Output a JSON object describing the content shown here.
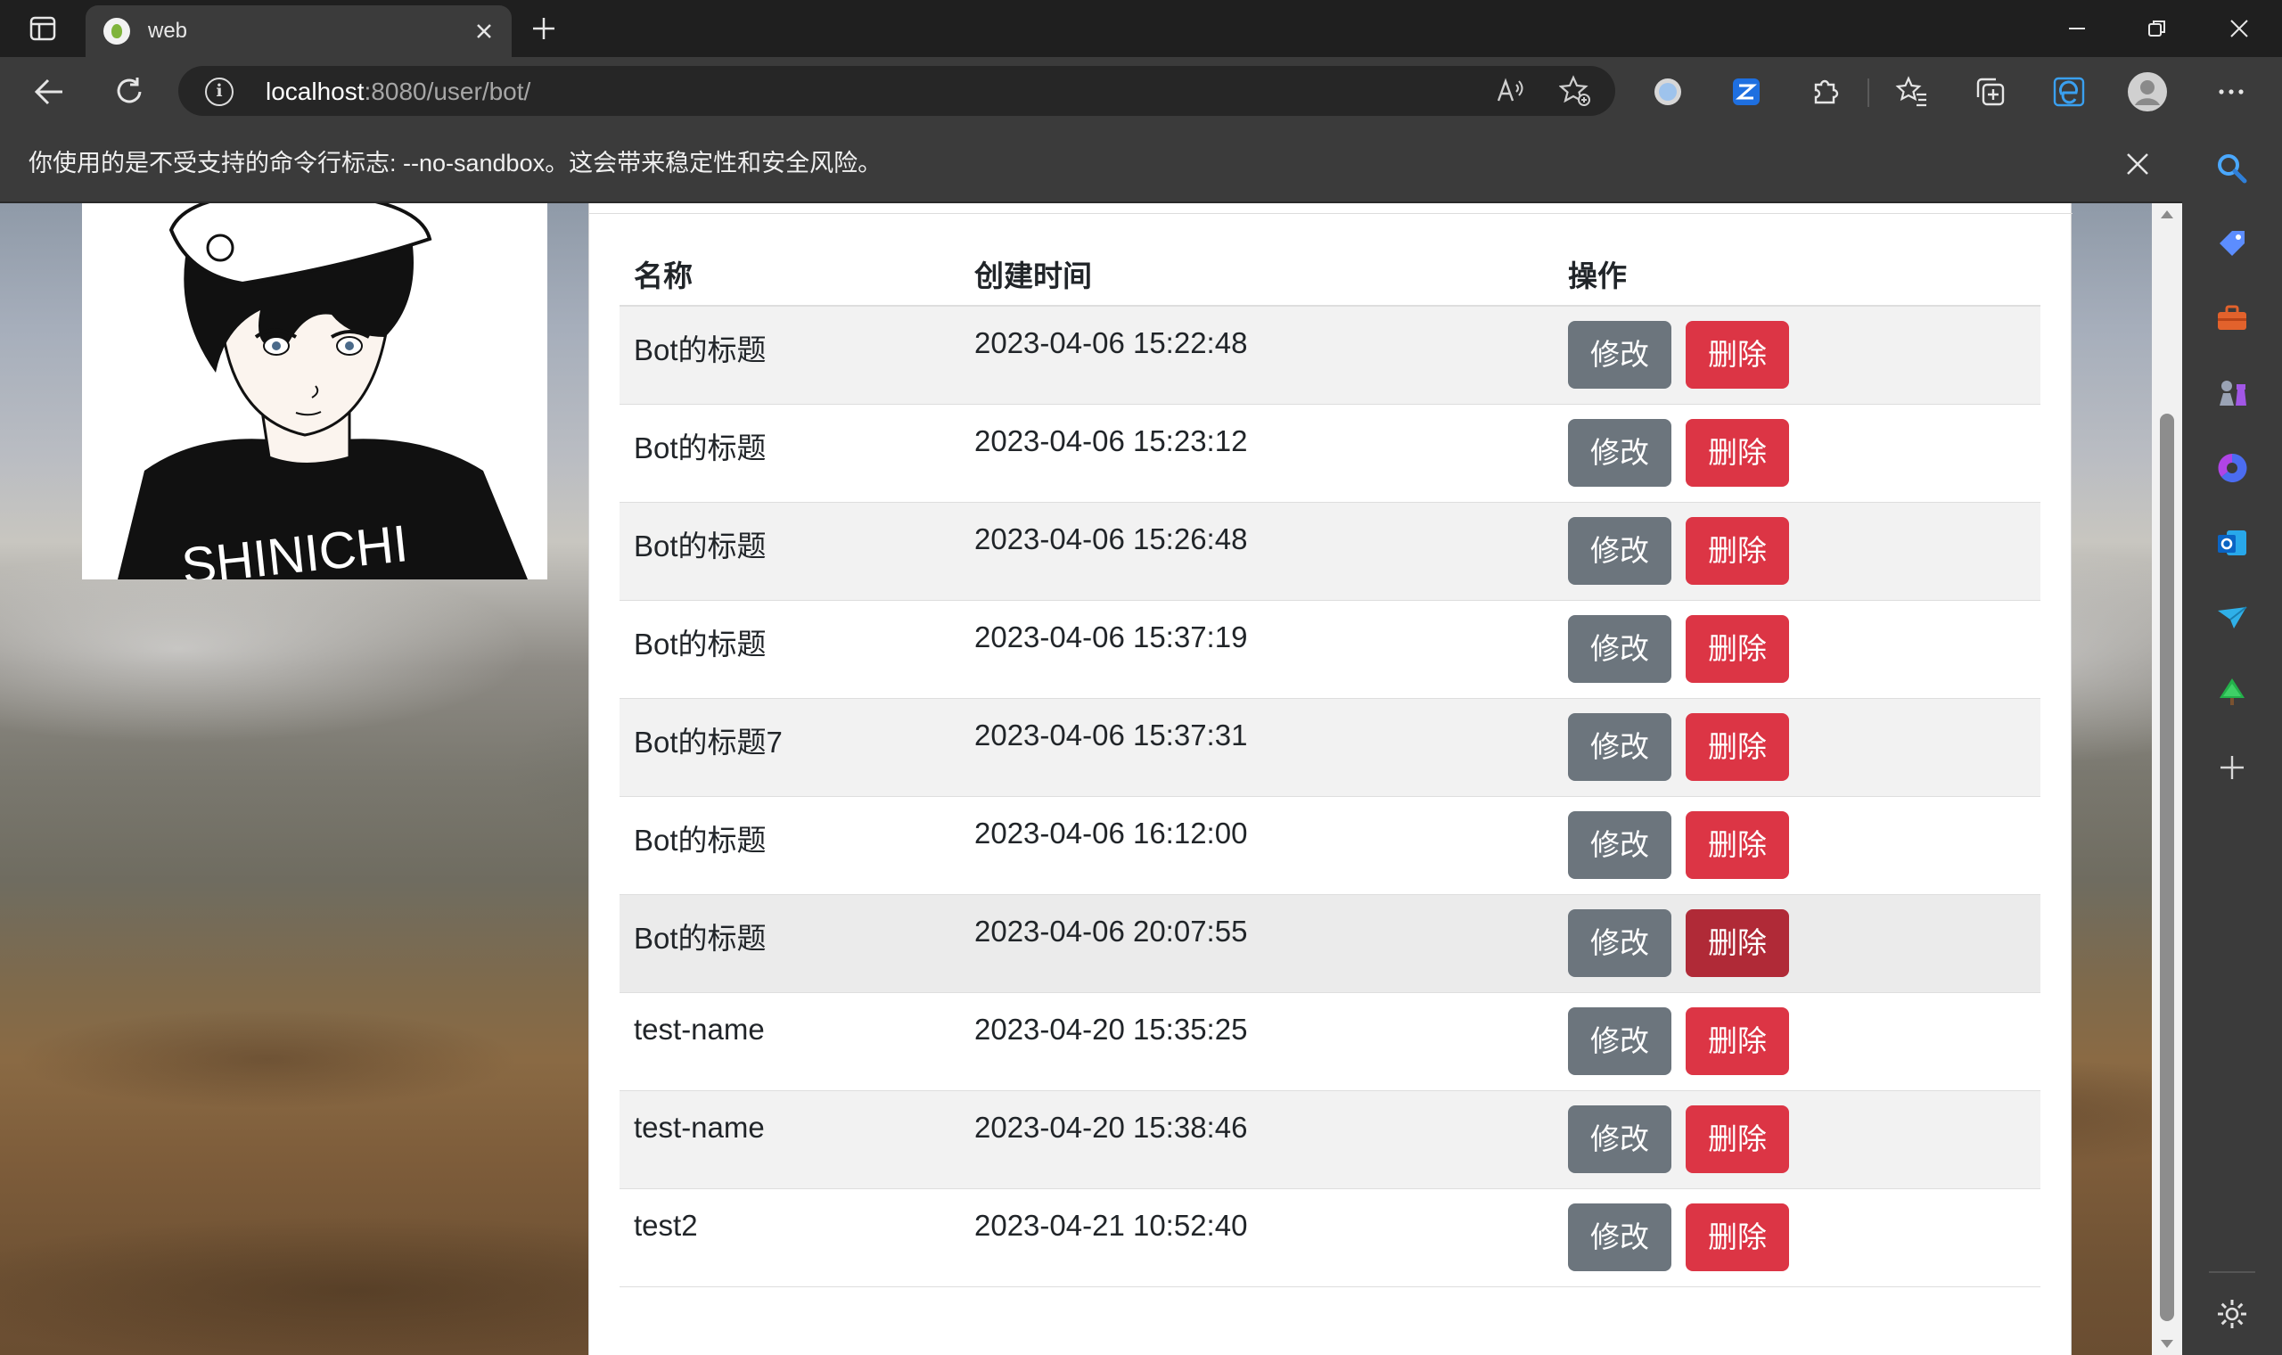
{
  "browser": {
    "tab_title": "web",
    "url_host": "localhost",
    "url_rest": ":8080/user/bot/",
    "infobar_message": "你使用的是不受支持的命令行标志: --no-sandbox。这会带来稳定性和安全风险。"
  },
  "avatar": {
    "shirt_text": "SHINICHI"
  },
  "table": {
    "headers": {
      "name": "名称",
      "created": "创建时间",
      "actions": "操作"
    },
    "rows": [
      {
        "name": "Bot的标题",
        "created": "2023-04-06 15:22:48",
        "edit": "修改",
        "delete": "删除"
      },
      {
        "name": "Bot的标题",
        "created": "2023-04-06 15:23:12",
        "edit": "修改",
        "delete": "删除"
      },
      {
        "name": "Bot的标题",
        "created": "2023-04-06 15:26:48",
        "edit": "修改",
        "delete": "删除"
      },
      {
        "name": "Bot的标题",
        "created": "2023-04-06 15:37:19",
        "edit": "修改",
        "delete": "删除"
      },
      {
        "name": "Bot的标题7",
        "created": "2023-04-06 15:37:31",
        "edit": "修改",
        "delete": "删除"
      },
      {
        "name": "Bot的标题",
        "created": "2023-04-06 16:12:00",
        "edit": "修改",
        "delete": "删除"
      },
      {
        "name": "Bot的标题",
        "created": "2023-04-06 20:07:55",
        "edit": "修改",
        "delete": "删除"
      },
      {
        "name": "test-name",
        "created": "2023-04-20 15:35:25",
        "edit": "修改",
        "delete": "删除"
      },
      {
        "name": "test-name",
        "created": "2023-04-20 15:38:46",
        "edit": "修改",
        "delete": "删除"
      },
      {
        "name": "test2",
        "created": "2023-04-21 10:52:40",
        "edit": "修改",
        "delete": "删除"
      }
    ]
  },
  "colors": {
    "edit_button": "#6c757d",
    "delete_button": "#dc3545",
    "delete_button_active": "#b02a37",
    "chrome_dark": "#1f1f1f",
    "chrome_toolbar": "#3b3b3b"
  },
  "icons": {
    "browser_toolbar": [
      "back-icon",
      "refresh-icon",
      "info-icon",
      "read-aloud-icon",
      "add-favorite-icon",
      "extension-circle-icon",
      "extension-z-icon",
      "extensions-puzzle-icon",
      "favorites-icon",
      "collections-icon",
      "edge-icon",
      "profile-avatar-icon",
      "more-menu-icon"
    ],
    "sidebar": [
      "search-icon",
      "tag-icon",
      "toolbox-icon",
      "chess-icon",
      "copilot-icon",
      "outlook-icon",
      "send-icon",
      "tree-icon",
      "add-icon",
      "settings-gear-icon"
    ]
  }
}
